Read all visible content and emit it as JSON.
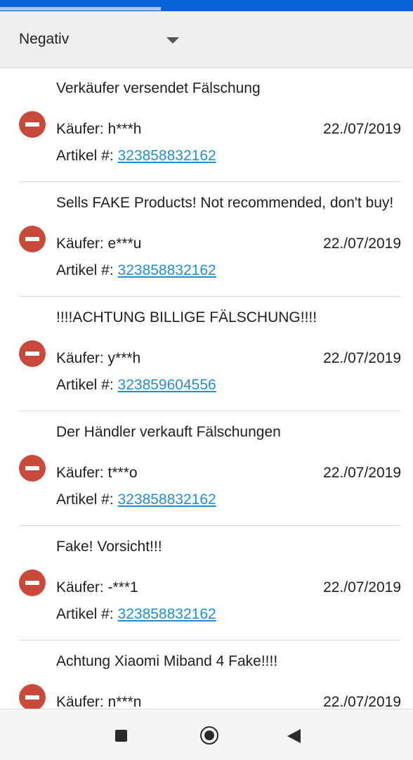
{
  "filter": {
    "selected": "Negativ",
    "icon": "chevron-down-icon"
  },
  "progress": {
    "fraction": 0.39
  },
  "feedback": [
    {
      "comment": "Verkäufer versendet Fälschung",
      "buyer": "Käufer: h***h",
      "date": "22./07/2019",
      "article_label": "Artikel #: ",
      "article_number": "323858832162"
    },
    {
      "comment": "Sells FAKE Products! Not recommended, don't buy!",
      "buyer": "Käufer: e***u",
      "date": "22./07/2019",
      "article_label": "Artikel #: ",
      "article_number": "323858832162"
    },
    {
      "comment": "!!!!ACHTUNG BILLIGE FÄLSCHUNG!!!!",
      "buyer": "Käufer: y***h",
      "date": "22./07/2019",
      "article_label": "Artikel #: ",
      "article_number": "323859604556"
    },
    {
      "comment": "Der Händler verkauft Fälschungen",
      "buyer": "Käufer: t***o",
      "date": "22./07/2019",
      "article_label": "Artikel #: ",
      "article_number": "323858832162"
    },
    {
      "comment": "Fake! Vorsicht!!!",
      "buyer": "Käufer: -***1",
      "date": "22./07/2019",
      "article_label": "Artikel #: ",
      "article_number": "323858832162"
    },
    {
      "comment": "Achtung Xiaomi Miband 4 Fake!!!!",
      "buyer": "Käufer: n***n",
      "date": "22./07/2019",
      "article_label": "Artikel #: ",
      "article_number": ""
    }
  ],
  "navbar": {
    "recents_icon": "square-icon",
    "home_icon": "circle-icon",
    "back_icon": "triangle-back-icon"
  },
  "colors": {
    "accent": "#0a64d6",
    "negative": "#c94a3b",
    "link": "#1f8fd6"
  }
}
